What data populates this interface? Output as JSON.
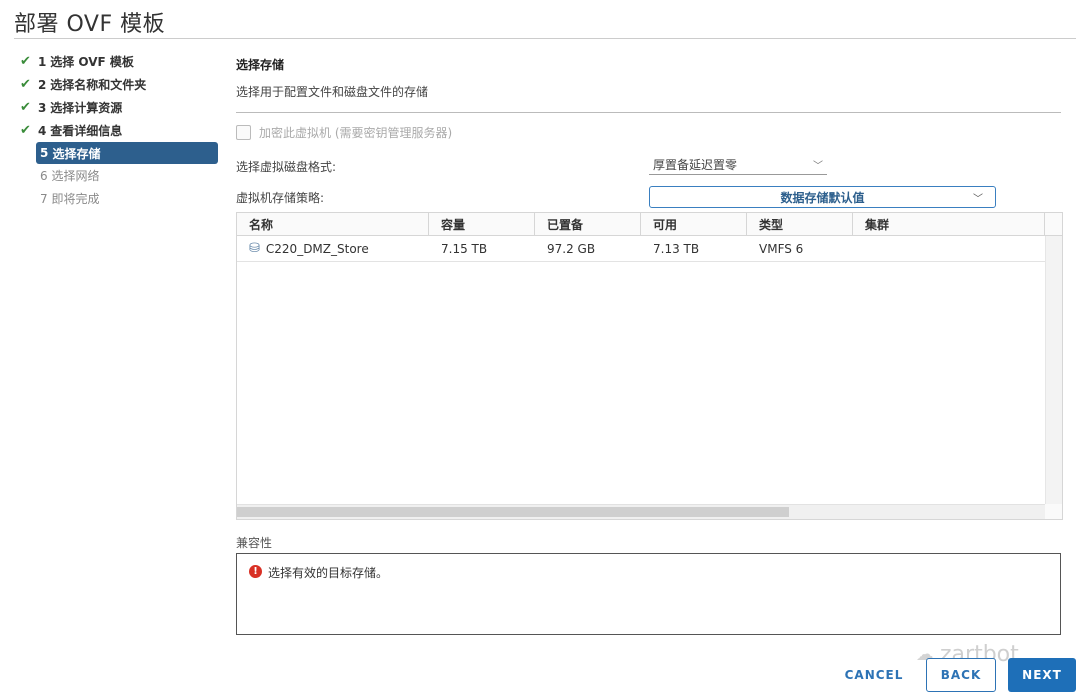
{
  "title": "部署 OVF 模板",
  "steps": [
    {
      "num": "1",
      "label": "选择 OVF 模板",
      "state": "done"
    },
    {
      "num": "2",
      "label": "选择名称和文件夹",
      "state": "done"
    },
    {
      "num": "3",
      "label": "选择计算资源",
      "state": "done"
    },
    {
      "num": "4",
      "label": "查看详细信息",
      "state": "done"
    },
    {
      "num": "5",
      "label": "选择存储",
      "state": "active"
    },
    {
      "num": "6",
      "label": "选择网络",
      "state": "todo"
    },
    {
      "num": "7",
      "label": "即将完成",
      "state": "todo"
    }
  ],
  "section": {
    "title": "选择存储",
    "description": "选择用于配置文件和磁盘文件的存储"
  },
  "encrypt": {
    "label": "加密此虚拟机 (需要密钥管理服务器)",
    "checked": false,
    "disabled": true
  },
  "disk_format": {
    "label": "选择虚拟磁盘格式:",
    "value": "厚置备延迟置零"
  },
  "storage_policy": {
    "label": "虚拟机存储策略:",
    "value": "数据存储默认值"
  },
  "grid": {
    "columns": [
      "名称",
      "容量",
      "已置备",
      "可用",
      "类型",
      "集群"
    ],
    "rows": [
      {
        "name": "C220_DMZ_Store",
        "capacity": "7.15 TB",
        "provisioned": "97.2 GB",
        "free": "7.13 TB",
        "type": "VMFS 6",
        "cluster": ""
      }
    ]
  },
  "compat": {
    "label": "兼容性",
    "message": "选择有效的目标存储。"
  },
  "watermark": "zartbot",
  "buttons": {
    "cancel": "CANCEL",
    "back": "BACK",
    "next": "NEXT"
  },
  "colors": {
    "accent": "#1e6fb8",
    "active_step": "#2d5f8d",
    "check": "#3a8c3a",
    "error": "#d93025"
  },
  "icons": {
    "check": "check-icon",
    "datastore": "database-icon",
    "error": "error-icon",
    "chevron": "chevron-down-icon"
  }
}
